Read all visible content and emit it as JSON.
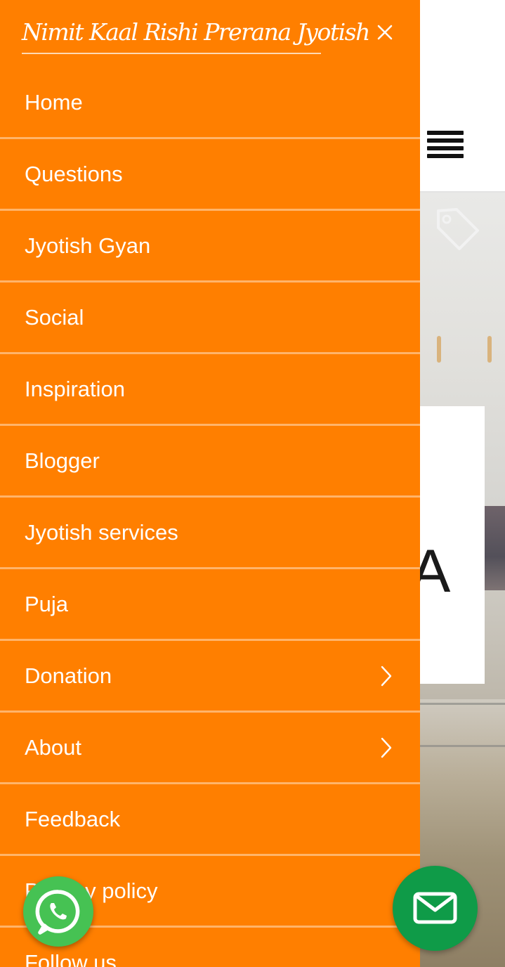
{
  "drawer": {
    "brand": "Nimit Kaal Rishi Prerana Jyotish",
    "background_color": "#ff7f00",
    "menu": [
      {
        "label": "Home",
        "has_submenu": false
      },
      {
        "label": "Questions",
        "has_submenu": false
      },
      {
        "label": "Jyotish Gyan",
        "has_submenu": false
      },
      {
        "label": "Social",
        "has_submenu": false
      },
      {
        "label": "Inspiration",
        "has_submenu": false
      },
      {
        "label": "Blogger",
        "has_submenu": false
      },
      {
        "label": "Jyotish services",
        "has_submenu": false
      },
      {
        "label": "Puja",
        "has_submenu": false
      },
      {
        "label": "Donation",
        "has_submenu": true
      },
      {
        "label": "About",
        "has_submenu": true
      },
      {
        "label": "Feedback",
        "has_submenu": false
      },
      {
        "label": "Privacy policy",
        "has_submenu": false
      },
      {
        "label": "Follow us",
        "has_submenu": false
      }
    ]
  },
  "background": {
    "card_letter": "A"
  },
  "floating": {
    "whatsapp_color": "#46c253",
    "mail_color": "#0f9b48"
  },
  "icons": {
    "close": "close-icon",
    "chevron": "chevron-right-icon",
    "menu": "hamburger-menu-icon",
    "tag": "tag-icon",
    "whatsapp": "whatsapp-icon",
    "mail": "mail-icon"
  }
}
